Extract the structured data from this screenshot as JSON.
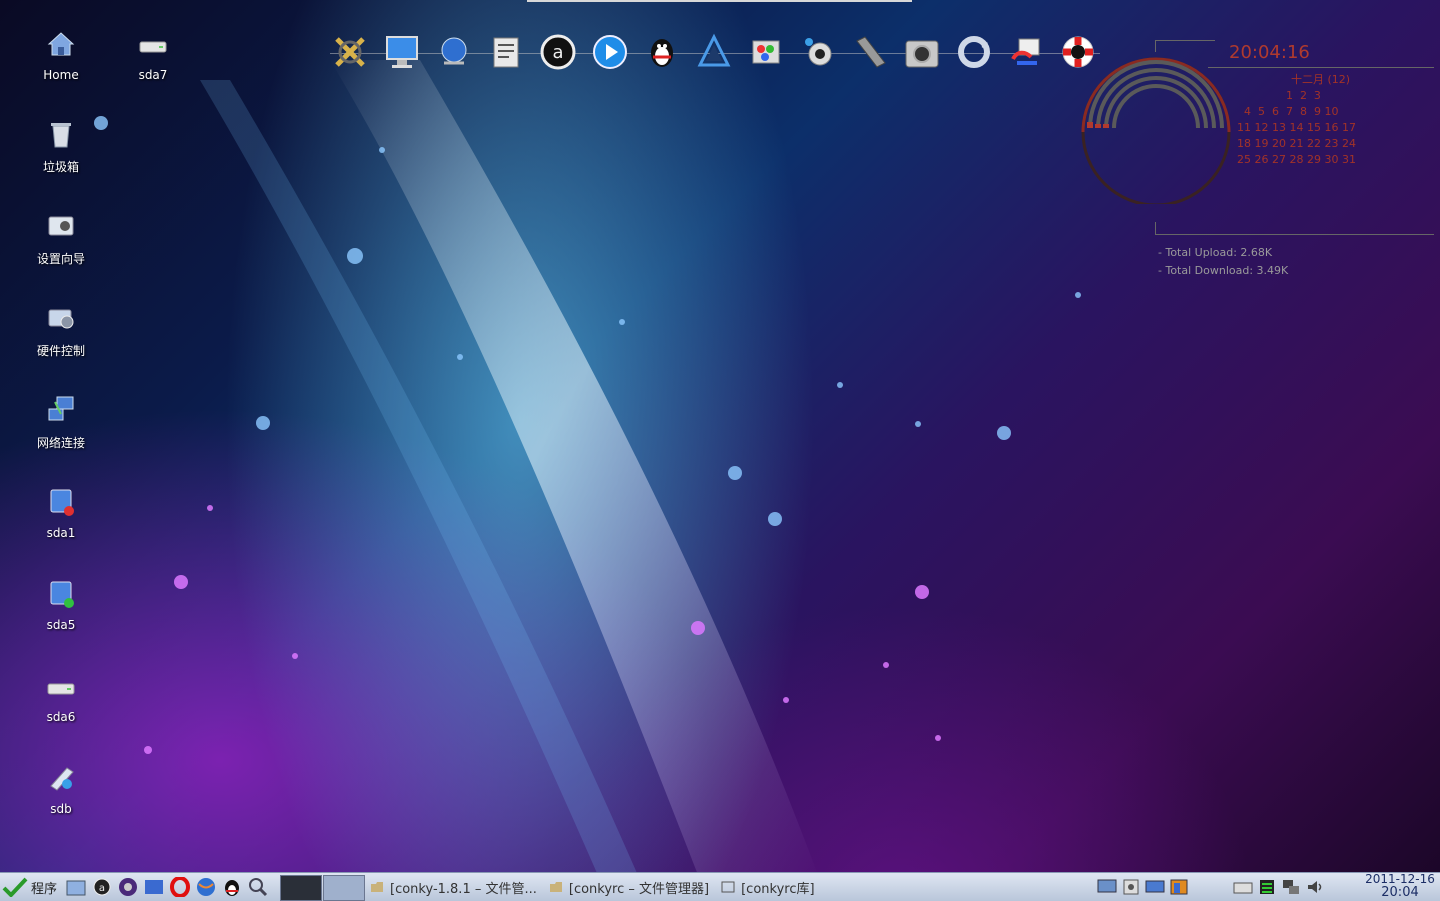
{
  "desktop_icons": [
    {
      "label": "Home",
      "icon": "home-icon"
    },
    {
      "label": "sda7",
      "icon": "drive-icon"
    },
    {
      "label": "垃圾箱",
      "icon": "trash-icon"
    },
    {
      "label": "设置向导",
      "icon": "setup-wizard-icon"
    },
    {
      "label": "硬件控制",
      "icon": "hardware-control-icon"
    },
    {
      "label": "网络连接",
      "icon": "network-connection-icon"
    },
    {
      "label": "sda1",
      "icon": "disk-icon"
    },
    {
      "label": "sda5",
      "icon": "disk-icon"
    },
    {
      "label": "sda6",
      "icon": "drive-icon"
    },
    {
      "label": "sdb",
      "icon": "usb-drive-icon"
    }
  ],
  "dock": {
    "items": [
      "xmms-icon",
      "monitor-icon",
      "globe-icon",
      "text-editor-icon",
      "a-icon",
      "media-player-icon",
      "qq-penguin-icon",
      "tools-icon",
      "paint-icon",
      "webcam-icon",
      "usb-stick-icon",
      "camera-icon",
      "sync-icon",
      "transfer-icon",
      "lifebuoy-icon"
    ]
  },
  "conky": {
    "time": "20:04:16",
    "calendar": {
      "header": "十二月 (12)",
      "rows": [
        "              1  2  3",
        "  4  5  6  7  8  9 10",
        "11 12 13 14 15 16 17",
        "18 19 20 21 22 23 24",
        "25 26 27 28 29 30 31"
      ]
    },
    "upload": "-  Total Upload:   2.68K",
    "download": "-  Total Download: 3.49K",
    "accent": "#b03a2e"
  },
  "taskbar": {
    "start_label": "程序",
    "quick_launch": [
      "file-manager-icon",
      "a-icon",
      "media-icon",
      "desktop-icon",
      "opera-icon",
      "browser-icon",
      "qq-penguin-icon",
      "search-icon"
    ],
    "tasks": [
      {
        "label": "[conky-1.8.1 – 文件管...",
        "icon": "folder-icon"
      },
      {
        "label": "[conkyrc – 文件管理器]",
        "icon": "folder-icon"
      },
      {
        "label": "[conkyrc库]",
        "icon": "window-icon"
      }
    ],
    "tray": [
      "display-icon",
      "device-icon",
      "monitor-icon",
      "package-icon",
      "keyboard-icon",
      "network-icon",
      "network-status-icon",
      "volume-icon"
    ],
    "clock_date": "2011-12-16",
    "clock_time": "20:04"
  }
}
